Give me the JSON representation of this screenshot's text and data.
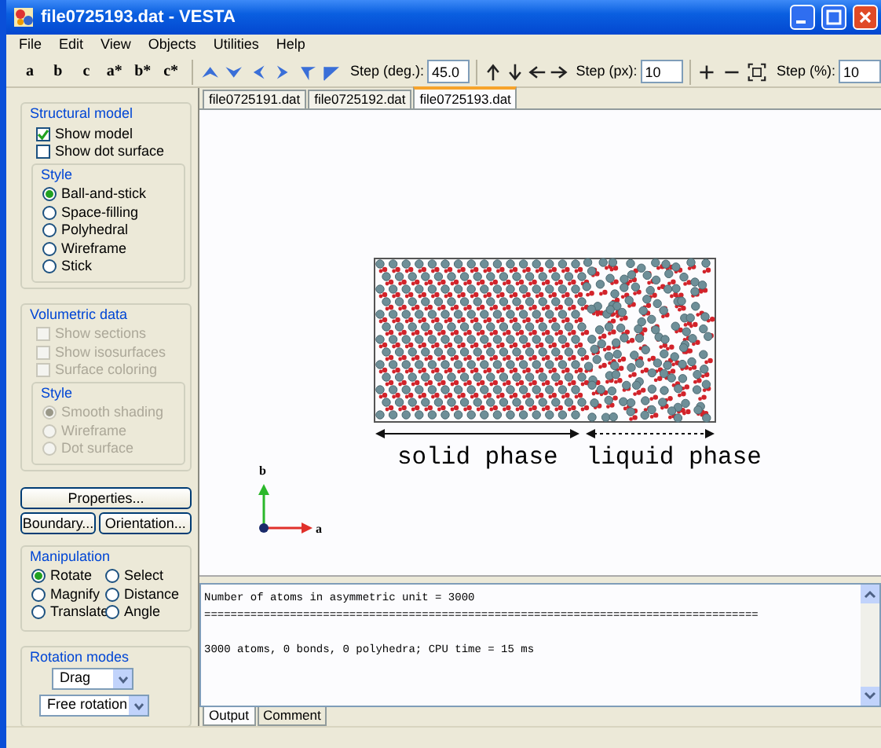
{
  "window": {
    "title": "file0725193.dat - VESTA"
  },
  "menu": [
    "File",
    "Edit",
    "View",
    "Objects",
    "Utilities",
    "Help"
  ],
  "toolbar": {
    "axis_buttons": [
      "a",
      "b",
      "c",
      "a*",
      "b*",
      "c*"
    ],
    "rotation_step": {
      "label": "Step (deg.):",
      "value": "45.0"
    },
    "translation_step": {
      "label": "Step (px):",
      "value": "10"
    },
    "zoom_step": {
      "label": "Step (%):",
      "value": "10"
    }
  },
  "side_panel": {
    "structural_model": {
      "title": "Structural model",
      "disabled": false,
      "checkboxes": [
        {
          "label": "Show model",
          "checked": true
        },
        {
          "label": "Show dot surface",
          "checked": false
        }
      ],
      "style": {
        "title": "Style",
        "options": [
          {
            "label": "Ball-and-stick",
            "selected": true
          },
          {
            "label": "Space-filling",
            "selected": false
          },
          {
            "label": "Polyhedral",
            "selected": false
          },
          {
            "label": "Wireframe",
            "selected": false
          },
          {
            "label": "Stick",
            "selected": false
          }
        ]
      }
    },
    "volumetric_data": {
      "title": "Volumetric data",
      "disabled": true,
      "checkboxes": [
        {
          "label": "Show sections",
          "checked": false
        },
        {
          "label": "Show isosurfaces",
          "checked": false
        },
        {
          "label": "Surface coloring",
          "checked": false
        }
      ],
      "style": {
        "title": "Style",
        "options": [
          {
            "label": "Smooth shading",
            "selected": true
          },
          {
            "label": "Wireframe",
            "selected": false
          },
          {
            "label": "Dot surface",
            "selected": false
          }
        ]
      }
    },
    "buttons": [
      "Properties...",
      "Boundary...",
      "Orientation..."
    ],
    "manipulation": {
      "title": "Manipulation",
      "options": [
        {
          "label": "Rotate",
          "selected": true
        },
        {
          "label": "Select",
          "selected": false
        },
        {
          "label": "Magnify",
          "selected": false
        },
        {
          "label": "Distance",
          "selected": false
        },
        {
          "label": "Translate",
          "selected": false
        },
        {
          "label": "Angle",
          "selected": false
        }
      ]
    },
    "rotation_modes": {
      "title": "Rotation modes",
      "selects": [
        "Drag",
        "Free rotation"
      ]
    }
  },
  "document_tabs": [
    {
      "label": "file0725191.dat",
      "selected": false
    },
    {
      "label": "file0725192.dat",
      "selected": false
    },
    {
      "label": "file0725193.dat",
      "selected": true
    }
  ],
  "viewport": {
    "phases": [
      {
        "label": "solid phase",
        "kind": "solid"
      },
      {
        "label": "liquid phase",
        "kind": "liquid"
      }
    ],
    "axes": [
      {
        "label": "b"
      },
      {
        "label": "a"
      }
    ]
  },
  "output": {
    "lines": [
      "Number of atoms in asymmetric unit = 3000",
      "====================================================================================",
      "3000 atoms, 0 bonds, 0 polyhedra; CPU time = 15 ms"
    ],
    "tabs": [
      {
        "label": "Output",
        "selected": true
      },
      {
        "label": "Comment",
        "selected": false
      }
    ]
  }
}
